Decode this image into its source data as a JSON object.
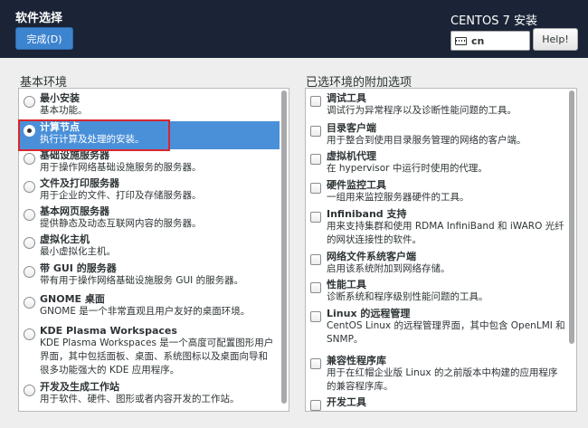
{
  "header": {
    "title": "软件选择",
    "done_label": "完成(D)",
    "product": "CENTOS 7 安装",
    "keyboard_layout": "cn",
    "keyboard_icon": "keyboard-icon",
    "help_label": "Help!"
  },
  "base_env": {
    "title": "基本环境",
    "items": [
      {
        "name": "最小安装",
        "desc": "基本功能。"
      },
      {
        "name": "计算节点",
        "desc": "执行计算及处理的安装。"
      },
      {
        "name": "基础设施服务器",
        "desc": "用于操作网络基础设施服务的服务器。"
      },
      {
        "name": "文件及打印服务器",
        "desc": "用于企业的文件、打印及存储服务器。"
      },
      {
        "name": "基本网页服务器",
        "desc": "提供静态及动态互联网内容的服务器。"
      },
      {
        "name": "虚拟化主机",
        "desc": "最小虚拟化主机。"
      },
      {
        "name": "带 GUI 的服务器",
        "desc": "带有用于操作网络基础设施服务 GUI 的服务器。"
      },
      {
        "name": "GNOME 桌面",
        "desc": "GNOME 是一个非常直观且用户友好的桌面环境。"
      },
      {
        "name": "KDE Plasma Workspaces",
        "desc_lines": [
          "KDE Plasma Workspaces 是一个高度可配置图形用户",
          "界面，其中包括面板、桌面、系统图标以及桌面向导和",
          "很多功能强大的 KDE 应用程序。"
        ]
      },
      {
        "name": "开发及生成工作站",
        "desc": "用于软件、硬件、图形或者内容开发的工作站。"
      }
    ],
    "selected_index": 1
  },
  "addons": {
    "title": "已选环境的附加选项",
    "items": [
      {
        "name": "调试工具",
        "desc": "调试行为异常程序以及诊断性能问题的工具。"
      },
      {
        "name": "目录客户端",
        "desc": "用于整合到使用目录服务管理的网络的客户端。"
      },
      {
        "name": "虚拟机代理",
        "desc": "在 hypervisor 中运行时使用的代理。"
      },
      {
        "name": "硬件监控工具",
        "desc": "一组用来监控服务器硬件的工具。"
      },
      {
        "name": "Infiniband 支持",
        "desc_lines": [
          "用来支持集群和使用 RDMA InfiniBand 和 iWARO 光纤",
          "的网状连接性的软件。"
        ]
      },
      {
        "name": "网络文件系统客户端",
        "desc": "启用该系统附加到网络存储。"
      },
      {
        "name": "性能工具",
        "desc": "诊断系统和程序级别性能问题的工具。"
      },
      {
        "name": "Linux 的远程管理",
        "desc_lines": [
          "CentOS Linux 的远程管理界面，其中包含 OpenLMI 和",
          "SNMP。"
        ]
      },
      {
        "name": "兼容性程序库",
        "desc_lines": [
          "用于在红帽企业版 Linux 的之前版本中构建的应用程序",
          "的兼容程序库。"
        ]
      },
      {
        "name": "开发工具"
      }
    ]
  }
}
